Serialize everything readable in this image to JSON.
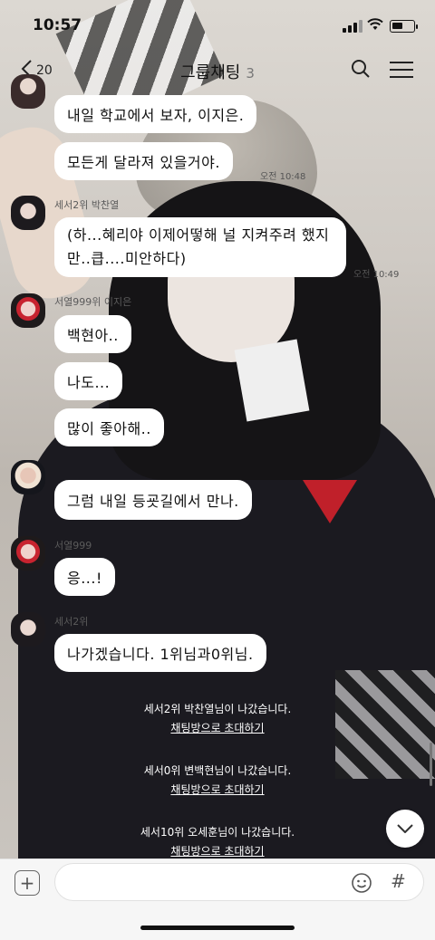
{
  "status_bar": {
    "time": "10:57"
  },
  "header": {
    "back_count": "20",
    "title": "그룹채팅",
    "member_count": "3"
  },
  "messages": [
    {
      "text": "내일 학교에서 보자, 이지은."
    },
    {
      "text": "모든게 달라져 있을거야.",
      "time": "오전 10:48"
    },
    {
      "sender": "세서2위 박찬열",
      "text": "(하...혜리야 이제어떻해 널 지켜주려 했지만..큽....미안하다)",
      "time": "오전 10:49"
    },
    {
      "sender": "서열999위 이지은",
      "text": "백현아.."
    },
    {
      "text": "나도..."
    },
    {
      "text": "많이 좋아해.."
    },
    {
      "text": "그럼 내일 등굣길에서 만나."
    },
    {
      "sender": "서열999",
      "text": "응...!"
    },
    {
      "sender": "세서2위",
      "text": "나가겠습니다. 1위님과0위님."
    }
  ],
  "notices": [
    {
      "text": "세서2위 박찬열님이 나갔습니다.",
      "link": "채팅방으로 초대하기"
    },
    {
      "text": "세서0위 변백현님이 나갔습니다.",
      "link": "채팅방으로 초대하기"
    },
    {
      "text": "세서10위 오세훈님이 나갔습니다.",
      "link": "채팅방으로 초대하기"
    }
  ],
  "input": {
    "placeholder": ""
  },
  "icons": {
    "back": "chevron-left-icon",
    "search": "search-icon",
    "menu": "hamburger-icon",
    "add": "plus-icon",
    "emoji": "emoji-icon",
    "hash": "hash-icon",
    "scroll": "chevron-down-icon"
  }
}
